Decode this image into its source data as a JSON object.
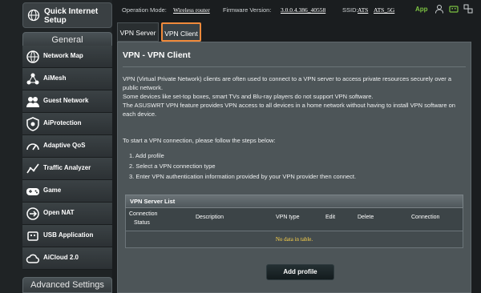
{
  "sidebar": {
    "quick_setup_line1": "Quick Internet",
    "quick_setup_line2": "Setup",
    "general_header": "General",
    "items": [
      {
        "label": "Network Map",
        "icon": "network-map-icon"
      },
      {
        "label": "AiMesh",
        "icon": "aimesh-icon"
      },
      {
        "label": "Guest Network",
        "icon": "guest-network-icon"
      },
      {
        "label": "AiProtection",
        "icon": "shield-icon"
      },
      {
        "label": "Adaptive QoS",
        "icon": "speedometer-icon"
      },
      {
        "label": "Traffic Analyzer",
        "icon": "traffic-analyzer-icon"
      },
      {
        "label": "Game",
        "icon": "gamepad-icon"
      },
      {
        "label": "Open NAT",
        "icon": "open-nat-icon"
      },
      {
        "label": "USB Application",
        "icon": "usb-icon"
      },
      {
        "label": "AiCloud 2.0",
        "icon": "cloud-icon"
      }
    ],
    "advanced_header": "Advanced Settings"
  },
  "topbar": {
    "op_mode_label": "Operation Mode:",
    "op_mode_value": "Wireless router",
    "firmware_label": "Firmware Version:",
    "firmware_value": "3.0.0.4.386_40558",
    "ssid_label": "SSID:",
    "ssid_1": "ATS",
    "ssid_2": "ATS_5G",
    "app_label": "App",
    "accent": "#7cc242"
  },
  "tabs": [
    {
      "label": "VPN Server",
      "active": false
    },
    {
      "label": "VPN Client",
      "active": true
    }
  ],
  "content": {
    "title": "VPN - VPN Client",
    "desc_1": "VPN (Virtual Private Network) clients are often used to connect to a VPN server to access private resources securely over a",
    "desc_2": "public network.",
    "desc_3": "Some devices like set-top boxes, smart TVs and Blu-ray players do not support VPN software.",
    "desc_4": "The ASUSWRT VPN feature provides VPN access to all devices in a home network without having to install VPN software on",
    "desc_5": "each device.",
    "steps_intro": "To start a VPN connection, please follow the steps below:",
    "step_1": "1. Add profile",
    "step_2": "2. Select a VPN connection type",
    "step_3": "3. Enter VPN authentication information provided by your VPN provider then connect."
  },
  "table": {
    "title": "VPN Server List",
    "col_status_1": "Connection",
    "col_status_2": "Status",
    "col_description": "Description",
    "col_vpn_type": "VPN type",
    "col_edit": "Edit",
    "col_delete": "Delete",
    "col_connection": "Connection",
    "empty_text": "No data in table."
  },
  "add_profile_label": "Add profile",
  "highlight_color": "#f08a3b"
}
